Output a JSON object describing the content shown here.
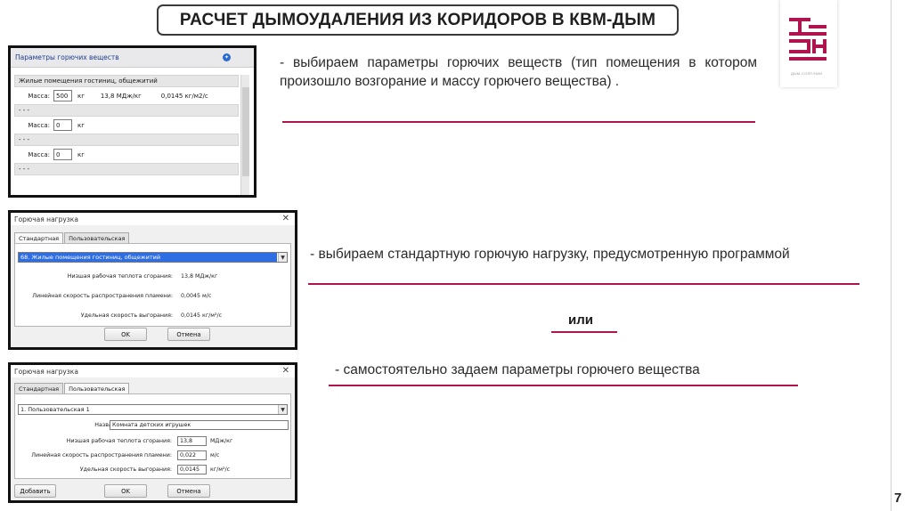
{
  "slide": {
    "title": "РАСЧЕТ ДЫМОУДАЛЕНИЯ ИЗ КОРИДОРОВ В КВМ-ДЫМ",
    "page_number": "7",
    "logo_caption": "ДЫМ-СОФТ/НИИ",
    "brand_color": "#b0144f",
    "bullets": [
      "- выбираем параметры горючих веществ (тип помещения в котором произошло возгорание и массу горючего вещества) .",
      "- выбираем стандартную горючую нагрузку, предусмотренную программой",
      "- самостоятельно задаем параметры горючего вещества"
    ],
    "or_label": "или"
  },
  "shot1": {
    "header": "Параметры горючих веществ",
    "help_icon": "info-icon",
    "row1_title": "Жилые помещения гостиниц, общежитий",
    "mass_label": "Масса:",
    "mass1": "500",
    "unit_kg": "кг",
    "heat": "13,8 МДж/кг",
    "burn": "0,0145 кг/м2/с",
    "dash": "- - -",
    "mass2": "0",
    "mass3": "0"
  },
  "shot2": {
    "window_title": "Горючая нагрузка",
    "tab_standard": "Стандартная",
    "tab_custom": "Пользовательская",
    "selected": "68. Жилые помещения гостиниц, общежитий",
    "heat_label": "Низшая рабочая теплота сгорания:",
    "heat_value": "13,8 МДж/кг",
    "flame_label": "Линейная скорость распространения пламени:",
    "flame_value": "0,0045  м/с",
    "burn_label": "Удельная скорость выгорания:",
    "burn_value": "0,0145  кг/м²/с",
    "ok": "OK",
    "cancel": "Отмена"
  },
  "shot3": {
    "window_title": "Горючая нагрузка",
    "tab_standard": "Стандартная",
    "tab_custom": "Пользовательская",
    "selected": "1. Пользовательская 1",
    "name_label": "Название:",
    "name_value": "Комната детских игрушек",
    "heat_label": "Низшая рабочая теплота сгорания:",
    "heat_value": "13,8",
    "heat_unit": "МДж/кг",
    "flame_label": "Линейная скорость распространения пламени:",
    "flame_value": "0,022",
    "flame_unit": "м/с",
    "burn_label": "Удельная скорость выгорания:",
    "burn_value": "0,0145",
    "burn_unit": "кг/м²/с",
    "add": "Добавить",
    "ok": "OK",
    "cancel": "Отмена"
  }
}
